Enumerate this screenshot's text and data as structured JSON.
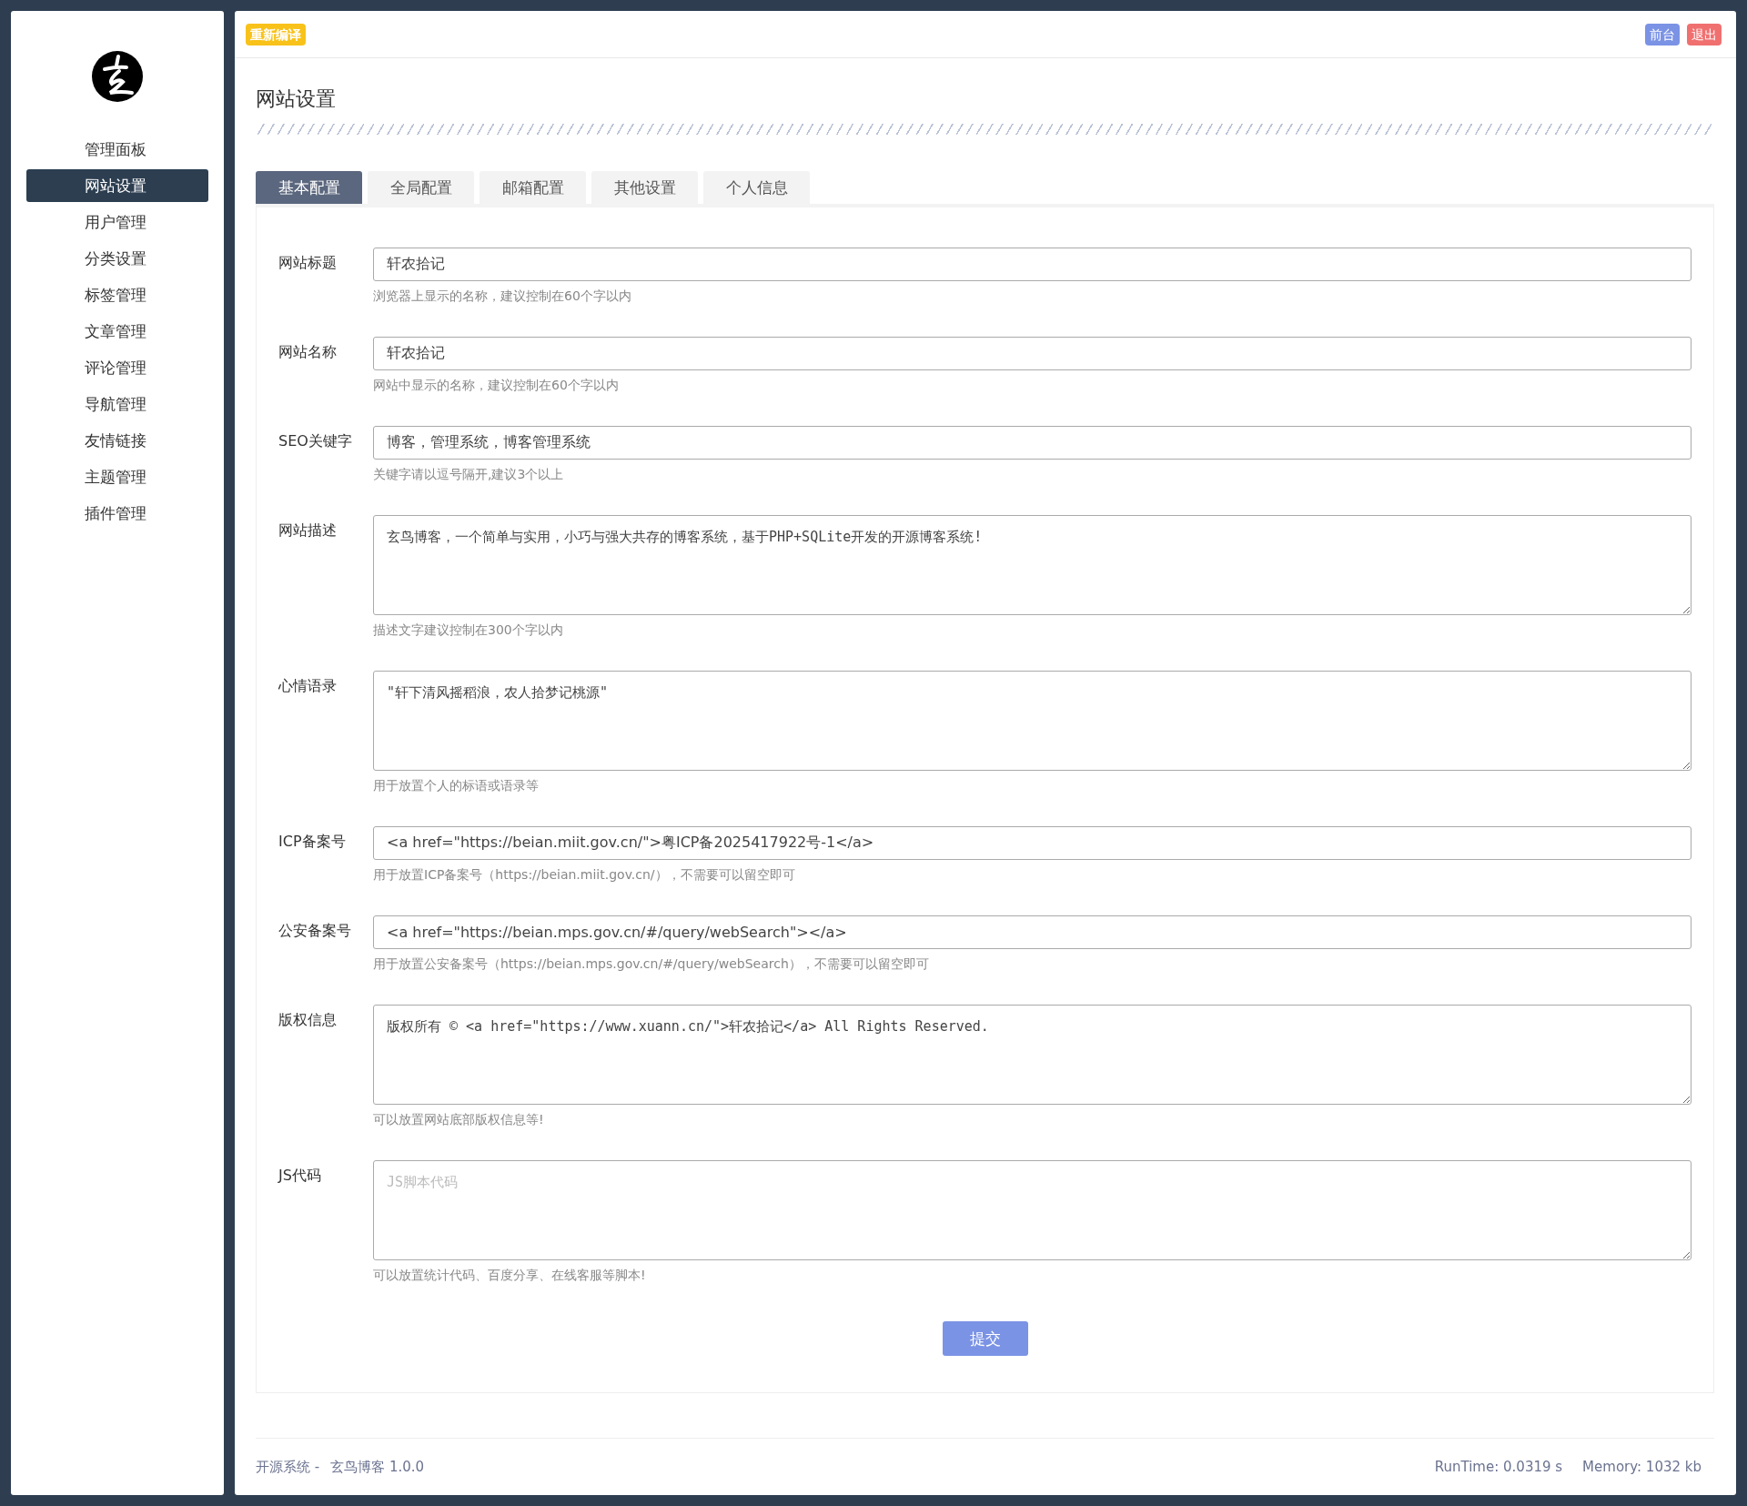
{
  "sidebar": {
    "items": [
      {
        "label": "管理面板",
        "selected": false
      },
      {
        "label": "网站设置",
        "selected": true
      },
      {
        "label": "用户管理",
        "selected": false
      },
      {
        "label": "分类设置",
        "selected": false
      },
      {
        "label": "标签管理",
        "selected": false
      },
      {
        "label": "文章管理",
        "selected": false
      },
      {
        "label": "评论管理",
        "selected": false
      },
      {
        "label": "导航管理",
        "selected": false
      },
      {
        "label": "友情链接",
        "selected": false
      },
      {
        "label": "主题管理",
        "selected": false
      },
      {
        "label": "插件管理",
        "selected": false
      }
    ]
  },
  "topbar": {
    "recompile": "重新编译",
    "front": "前台",
    "logout": "退出"
  },
  "page_title": "网站设置",
  "tabs": [
    {
      "label": "基本配置",
      "selected": true
    },
    {
      "label": "全局配置",
      "selected": false
    },
    {
      "label": "邮箱配置",
      "selected": false
    },
    {
      "label": "其他设置",
      "selected": false
    },
    {
      "label": "个人信息",
      "selected": false
    }
  ],
  "fields": [
    {
      "kind": "input",
      "label": "网站标题",
      "value": "轩农拾记",
      "hint": "浏览器上显示的名称，建议控制在60个字以内"
    },
    {
      "kind": "input",
      "label": "网站名称",
      "value": "轩农拾记",
      "hint": "网站中显示的名称，建议控制在60个字以内"
    },
    {
      "kind": "input",
      "label": "SEO关键字",
      "value": "博客，管理系统，博客管理系统",
      "hint": "关键字请以逗号隔开,建议3个以上"
    },
    {
      "kind": "textarea",
      "label": "网站描述",
      "value": "玄鸟博客，一个简单与实用，小巧与强大共存的博客系统，基于PHP+SQLite开发的开源博客系统!",
      "hint": "描述文字建议控制在300个字以内"
    },
    {
      "kind": "textarea",
      "label": "心情语录",
      "value": "\"轩下清风摇稻浪，农人拾梦记桃源\"",
      "hint": "用于放置个人的标语或语录等"
    },
    {
      "kind": "input",
      "label": "ICP备案号",
      "value": "<a href=\"https://beian.miit.gov.cn/\">粤ICP备2025417922号-1</a>",
      "hint": "用于放置ICP备案号（https://beian.miit.gov.cn/），不需要可以留空即可"
    },
    {
      "kind": "input",
      "label": "公安备案号",
      "value": "<a href=\"https://beian.mps.gov.cn/#/query/webSearch\"></a>",
      "hint": "用于放置公安备案号（https://beian.mps.gov.cn/#/query/webSearch），不需要可以留空即可"
    },
    {
      "kind": "textarea",
      "label": "版权信息",
      "value": "版权所有 © <a href=\"https://www.xuann.cn/\">轩农拾记</a> All Rights Reserved.",
      "hint": "可以放置网站底部版权信息等!"
    },
    {
      "kind": "textarea",
      "label": "JS代码",
      "placeholder": "JS脚本代码",
      "hint": "可以放置统计代码、百度分享、在线客服等脚本!"
    }
  ],
  "submit": "提交",
  "footer": {
    "left_prefix": "开源系统 -",
    "product": "玄鸟博客 1.0.0",
    "runtime": "RunTime: 0.0319 s",
    "memory": "Memory: 1032 kb"
  }
}
